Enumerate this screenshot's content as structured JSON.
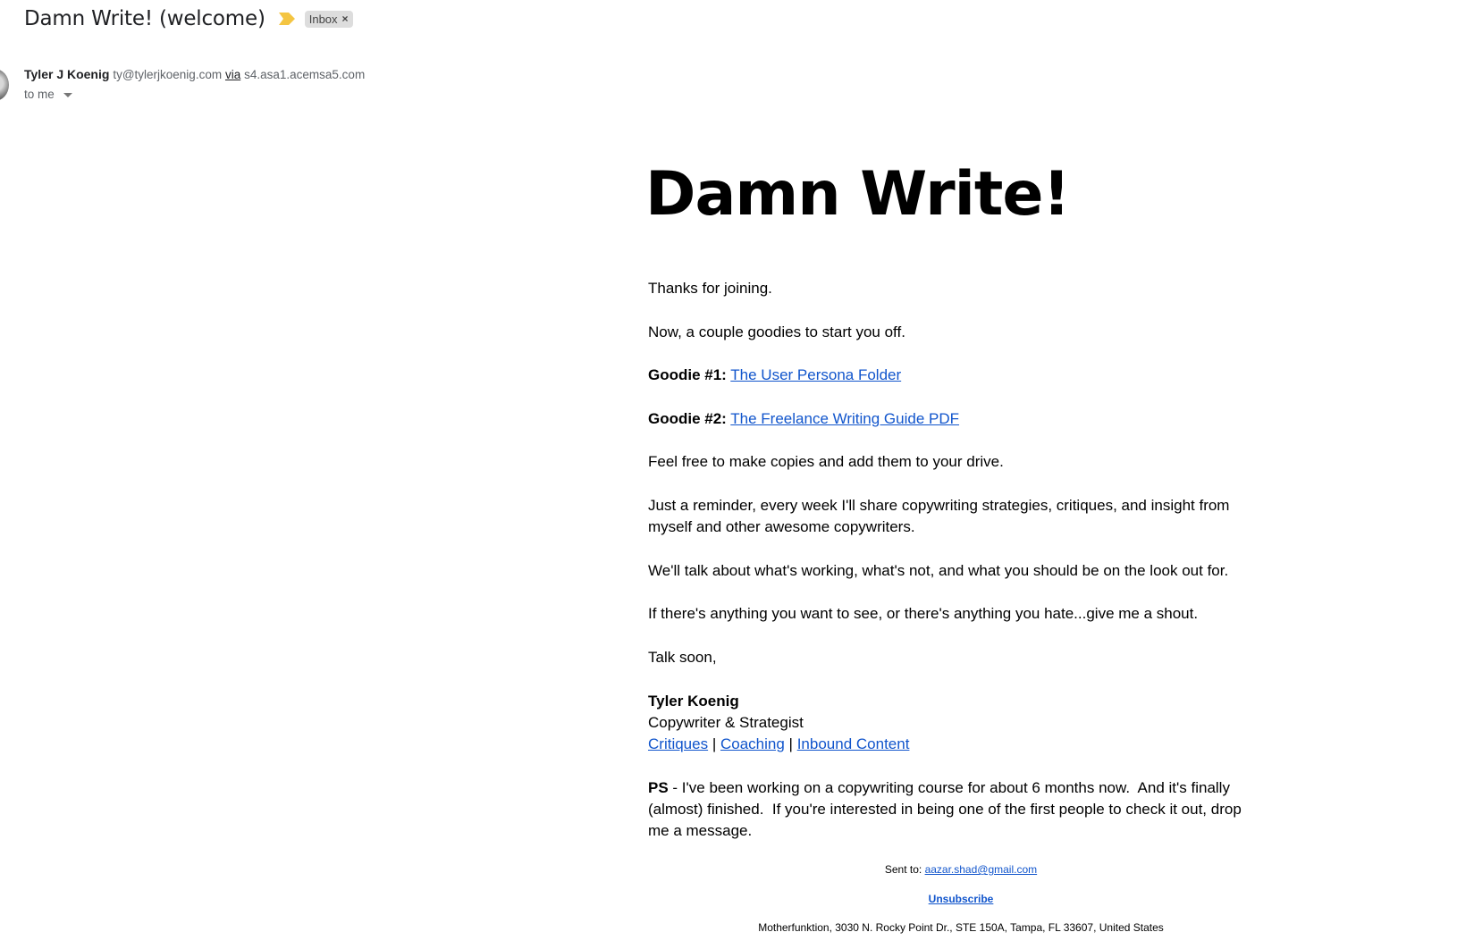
{
  "header": {
    "subject": "Damn Write! (welcome)",
    "importance_icon": "importance-marker-icon",
    "importance_color": "#f4c542",
    "label": "Inbox",
    "label_remove": "×"
  },
  "sender": {
    "name": "Tyler J Koenig",
    "email": "ty@tylerjkoenig.com",
    "via_label": "via",
    "via_domain": "s4.asa1.acemsa5.com",
    "recipient": "to me"
  },
  "email": {
    "heading": "Damn Write!",
    "paragraphs": {
      "p1": "Thanks for joining.",
      "p2": "Now, a couple goodies to start you off.",
      "goodie1_label": "Goodie #1:",
      "goodie1_link": "The User Persona Folder",
      "goodie2_label": "Goodie #2:",
      "goodie2_link": "The Freelance Writing Guide PDF",
      "p3": "Feel free to make copies and add them to your drive.",
      "p4": "Just a reminder, every week I'll share copywriting strategies, critiques, and insight from myself and other awesome copywriters.",
      "p5": "We'll talk about what's working, what's not, and what you should be on the look out for.",
      "p6": "If there's anything you want to see, or there's anything you hate...give me a shout.",
      "p7": "Talk soon,"
    },
    "signature": {
      "name": "Tyler Koenig",
      "title": "Copywriter & Strategist",
      "links": [
        "Critiques",
        "Coaching",
        "Inbound Content"
      ],
      "separator": "|"
    },
    "ps": {
      "label": "PS",
      "text": " - I've been working on a copywriting course for about 6 months now.  And it's finally (almost) finished.  If you're interested in being one of the first people to check it out, drop me a message."
    },
    "footer": {
      "sent_to_label": "Sent to: ",
      "sent_to_email": "aazar.shad@gmail.com",
      "unsubscribe": "Unsubscribe",
      "address": "Motherfunktion, 3030 N. Rocky Point Dr., STE 150A, Tampa, FL 33607, United States"
    }
  },
  "colors": {
    "link": "#1155cc",
    "chip_bg": "#dddddd"
  }
}
